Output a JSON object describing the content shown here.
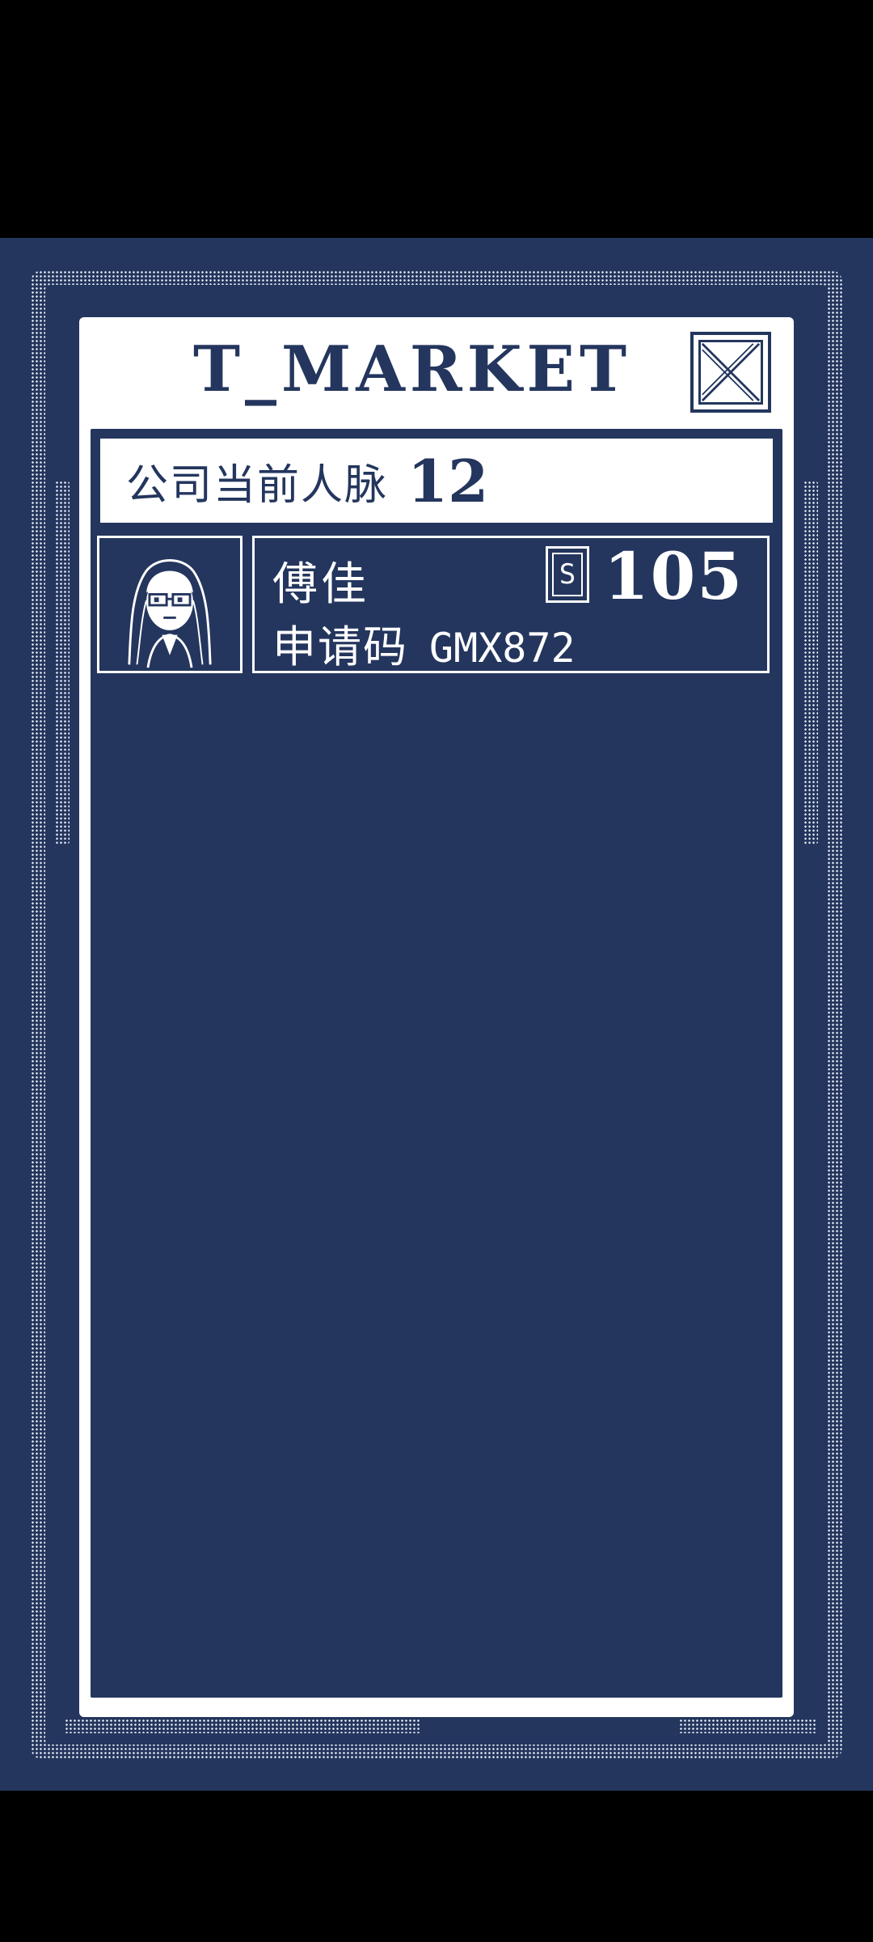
{
  "panel": {
    "title": "T_MARKET",
    "close_icon": "close-x-icon"
  },
  "contacts": {
    "label": "公司当前人脉",
    "value": "12"
  },
  "entries": [
    {
      "avatar_icon": "avatar-glasses-long-hair-icon",
      "name": "傅佳",
      "code_label": "申请码",
      "code_value": "GMX872",
      "score_icon_letter": "S",
      "score_icon": "s-card-icon",
      "score_value": "105"
    }
  ],
  "colors": {
    "background": "#24365e",
    "panel": "#ffffff",
    "letterbox": "#000000"
  }
}
